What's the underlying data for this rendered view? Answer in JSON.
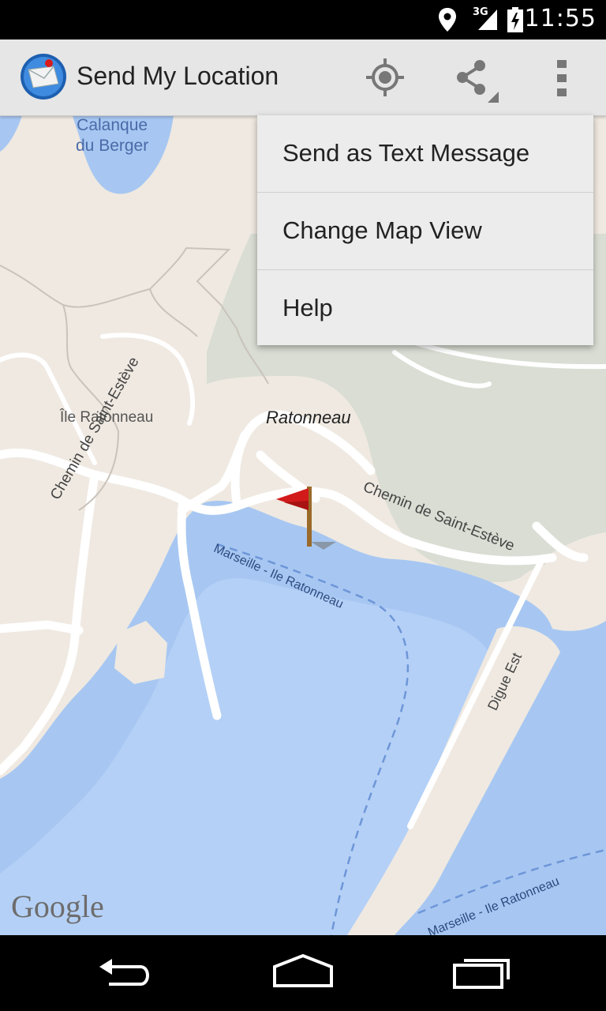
{
  "status_bar": {
    "time": "11:55",
    "network": "3G",
    "icons": [
      "location-icon",
      "signal-icon",
      "battery-icon"
    ]
  },
  "action_bar": {
    "title": "Send My Location",
    "actions": [
      "crosshair-icon",
      "share-icon",
      "overflow-menu-icon"
    ]
  },
  "overflow_menu": {
    "items": [
      {
        "label": "Send as Text Message"
      },
      {
        "label": "Change Map View"
      },
      {
        "label": "Help"
      }
    ]
  },
  "map": {
    "labels": {
      "calanque": "Calanque\ndu Berger",
      "ile_ratonneau": "Île Ratonneau",
      "ratonneau": "Ratonneau",
      "chemin_left": "Chemin de Saint-Estève",
      "chemin_right": "Chemin de Saint-Estève",
      "ferry_route": "Marseille - Ile Ratonneau",
      "ferry_route_2": "Marseille - Ile Ratonneau",
      "digue": "Digue Est",
      "watermark": "Google"
    }
  },
  "colors": {
    "land": "#efe9e1",
    "water": "#a7c7f2",
    "water_dark": "#96b8ec",
    "road": "#ffffff",
    "park": "#d9ddd3",
    "action_bar": "#e6e6e6",
    "flag": "#d21a1a"
  },
  "nav_bar": {
    "icons": [
      "back-icon",
      "home-icon",
      "recent-apps-icon"
    ]
  }
}
